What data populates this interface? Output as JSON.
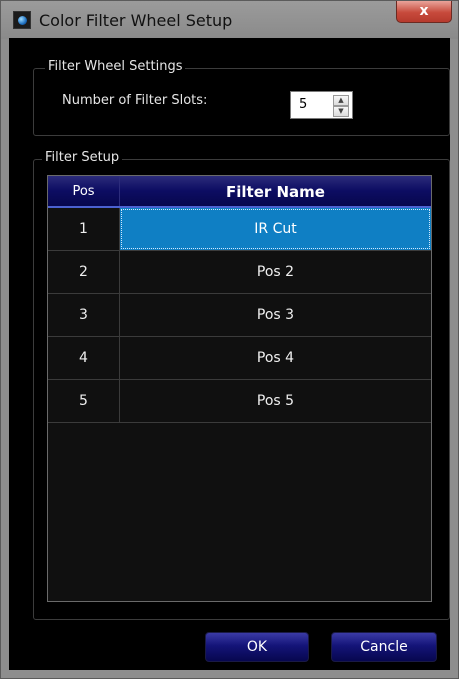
{
  "window": {
    "title": "Color Filter Wheel Setup",
    "close_label": "x"
  },
  "wheel_settings": {
    "legend": "Filter Wheel Settings",
    "slots_label": "Number of Filter Slots:",
    "slots_value": "5",
    "spin_up": "▲",
    "spin_down": "▼"
  },
  "filter_setup": {
    "legend": "Filter Setup",
    "columns": [
      "Pos",
      "Filter Name"
    ],
    "rows": [
      {
        "pos": "1",
        "name": "IR Cut",
        "selected": true
      },
      {
        "pos": "2",
        "name": "Pos 2"
      },
      {
        "pos": "3",
        "name": "Pos 3"
      },
      {
        "pos": "4",
        "name": "Pos 4"
      },
      {
        "pos": "5",
        "name": "Pos 5"
      }
    ]
  },
  "buttons": {
    "ok": "OK",
    "cancel": "Cancle"
  },
  "colors": {
    "selection": "#0f7fc4",
    "header": "#0d0d63",
    "background": "#000000"
  }
}
